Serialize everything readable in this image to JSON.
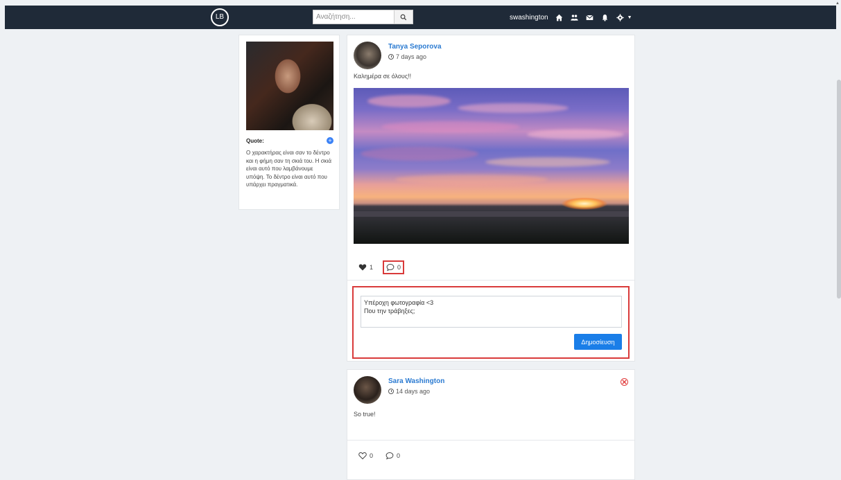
{
  "navbar": {
    "logo_text": "LB",
    "search_placeholder": "Αναζήτηση...",
    "username": "swashington",
    "icons": [
      "home-icon",
      "friends-icon",
      "mail-icon",
      "bell-icon",
      "settings-icon"
    ]
  },
  "profile": {
    "quote_title": "Quote:",
    "quote_text": "Ο χαρακτήρας είναι σαν το δέντρο και η φήμη σαν τη σκιά του. Η σκιά είναι αυτό που λαμβάνουμε υπόψη. Το δέντρο είναι αυτό που υπάρχει πραγματικά."
  },
  "posts": [
    {
      "author": "Tanya Seporova",
      "time": "7 days ago",
      "text": "Καλημέρα σε όλους!!",
      "likes": "1",
      "comments": "0",
      "liked": true
    },
    {
      "author": "Sara Washington",
      "time": "14 days ago",
      "text": "So true!",
      "likes": "0",
      "comments": "0",
      "liked": false
    }
  ],
  "comment_form": {
    "value": "Υπέροχη φωτογραφία <3\nΠου την τράβηξες;",
    "submit_label": "Δημοσίευση"
  },
  "colors": {
    "navbar": "#1f2a38",
    "link": "#2a7ad1",
    "button": "#1a7ee8",
    "highlight": "#d93a3a"
  }
}
